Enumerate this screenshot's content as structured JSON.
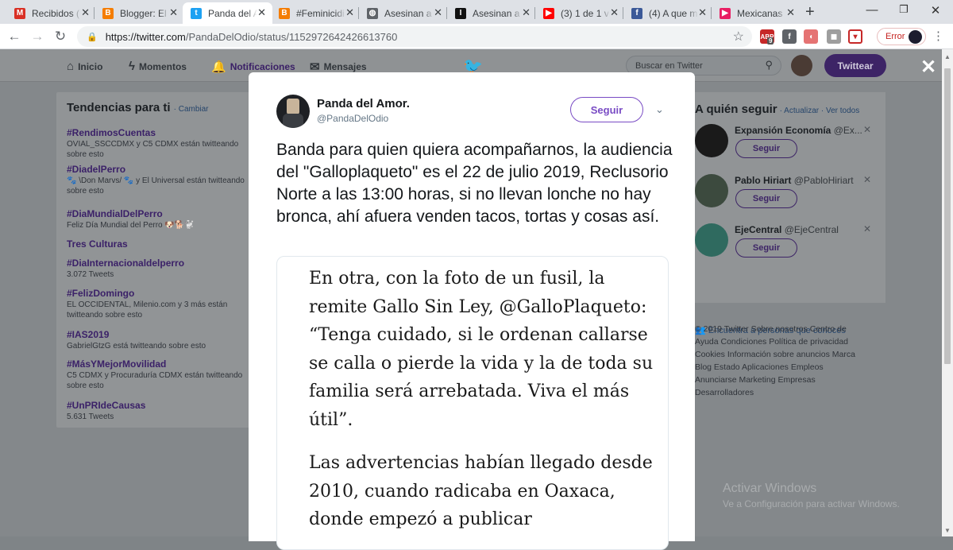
{
  "browser": {
    "tabs": [
      {
        "title": "Recibidos (",
        "icon": "gmail-icon",
        "color": "#d93025",
        "glyph": "M"
      },
      {
        "title": "Blogger: El",
        "icon": "blogger-icon",
        "color": "#f57d00",
        "glyph": "B"
      },
      {
        "title": "Panda del A",
        "icon": "twitter-icon",
        "color": "#1da1f2",
        "glyph": "t",
        "active": true
      },
      {
        "title": "#Feminicidi",
        "icon": "blogger-icon",
        "color": "#f57d00",
        "glyph": "B"
      },
      {
        "title": "Asesinan a",
        "icon": "globe-icon",
        "color": "#5f6368",
        "glyph": "◍"
      },
      {
        "title": "Asesinan a",
        "icon": "news-icon",
        "color": "#111111",
        "glyph": "I"
      },
      {
        "title": "(3) 1 de 1 vi",
        "icon": "youtube-icon",
        "color": "#ff0000",
        "glyph": "▶"
      },
      {
        "title": "(4) A que m",
        "icon": "facebook-icon",
        "color": "#3b5998",
        "glyph": "f"
      },
      {
        "title": "Mexicanas",
        "icon": "play-icon",
        "color": "#e91e63",
        "glyph": "▶"
      }
    ],
    "url_host": "https://twitter.com",
    "url_path": "/PandaDelOdio/status/1152972642426613760",
    "error_label": "Error",
    "ext_badge": "9"
  },
  "twitter": {
    "nav": {
      "home": "Inicio",
      "moments": "Momentos",
      "notifications": "Notificaciones",
      "messages": "Mensajes"
    },
    "search_placeholder": "Buscar en Twitter",
    "tweet_button": "Twittear",
    "trends": {
      "title": "Tendencias para ti",
      "change": "· Cambiar",
      "items": [
        {
          "tag": "#RendimosCuentas",
          "ctx": "OVIAL_SSCCDMX y C5 CDMX están twitteando sobre esto"
        },
        {
          "tag": "#DiadelPerro",
          "ctx": "🐾 \\Don Marvs/ 🐾 y El Universal están twitteando sobre esto"
        },
        {
          "tag": "#DiaMundialDelPerro",
          "ctx": "Feliz Día Mundial del Perro 🐶🐕🐩"
        },
        {
          "tag": "Tres Culturas",
          "ctx": ""
        },
        {
          "tag": "#DiaInternacionaldelperro",
          "ctx": "3.072 Tweets"
        },
        {
          "tag": "#FelizDomingo",
          "ctx": "EL OCCIDENTAL, Milenio.com y 3 más están twitteando sobre esto"
        },
        {
          "tag": "#IAS2019",
          "ctx": "GabrielGtzG está twitteando sobre esto"
        },
        {
          "tag": "#MásYMejorMovilidad",
          "ctx": "C5 CDMX y Procuraduría CDMX están twitteando sobre esto"
        },
        {
          "tag": "#UnPRIdeCausas",
          "ctx": "5.631 Tweets"
        }
      ]
    },
    "who_to_follow": {
      "title": "A quién seguir",
      "links": "· Actualizar · Ver todos",
      "accounts": [
        {
          "name": "Expansión Economía",
          "handle": "@Ex...",
          "button": "Seguir",
          "avatar_color": "#1a1a1a"
        },
        {
          "name": "Pablo Hiriart",
          "handle": "@PabloHiriart",
          "button": "Seguir",
          "avatar_color": "#3c4a3e"
        },
        {
          "name": "EjeCentral",
          "handle": "@EjeCentral",
          "button": "Seguir",
          "avatar_color": "#2f6a5f"
        }
      ],
      "find_people": "Encuentra a personas que conoces"
    },
    "footer_links": "© 2019 Twitter  Sobre nosotros  Centro de Ayuda  Condiciones  Política de privacidad  Cookies  Información sobre anuncios  Marca  Blog  Estado  Aplicaciones  Empleos  Anunciarse  Marketing  Empresas  Desarrolladores"
  },
  "tweet": {
    "name": "Panda del Amor.",
    "handle": "@PandaDelOdio",
    "follow_label": "Seguir",
    "text": "Banda para quien quiera acompañarnos, la audiencia del \"Galloplaqueto\" es el 22 de julio 2019, Reclusorio Norte a las 13:00 horas, si no llevan lonche no hay bronca, ahí afuera venden tacos, tortas y cosas así.",
    "media_paragraphs": [
      "En otra, con la foto de un fusil, la remite Gallo Sin Ley, @GalloPlaqueto: “Tenga cuidado, si le ordenan callarse se calla o pierde la vida y la de toda su familia será arrebatada. Viva el más útil”.",
      "Las advertencias habían llegado desde 2010, cuando radicaba en Oaxaca, donde empezó a publicar"
    ]
  },
  "watermark": {
    "line1": "Activar Windows",
    "line2": "Ve a Configuración para activar Windows."
  },
  "colors": {
    "accent": "#794bc4",
    "twitter_blue": "#1da1f2"
  }
}
